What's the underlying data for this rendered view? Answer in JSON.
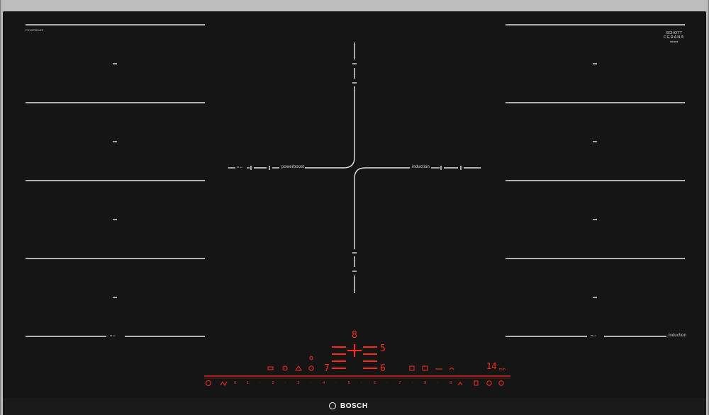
{
  "model_code": "PXV975DV1E",
  "brand": "BOSCH",
  "glass_brand": {
    "line1": "SCHOTT",
    "line2": "CERAN®",
    "line3": "miradur"
  },
  "zone_labels": {
    "center_left_logo": "≈∽",
    "powerboost": "powerboost",
    "induction_center": "induction",
    "bottom_left_logo": "≈∽",
    "bottom_right_logo": "≈∽",
    "induction_right": "induction"
  },
  "display": {
    "top_digit": "8",
    "left_digit": "7",
    "right_upper_digit": "5",
    "right_lower_digit": "6",
    "timer": "14",
    "timer_unit": "min"
  },
  "power_scale": [
    "0",
    "1",
    "·",
    "2",
    "·",
    "3",
    "·",
    "4",
    "·",
    "5",
    "·",
    "6",
    "·",
    "7",
    "·",
    "8",
    "·",
    "9"
  ],
  "colors": {
    "glass": "#161515",
    "line": "#e8e8e8",
    "control_red": "#ff2a1c"
  }
}
